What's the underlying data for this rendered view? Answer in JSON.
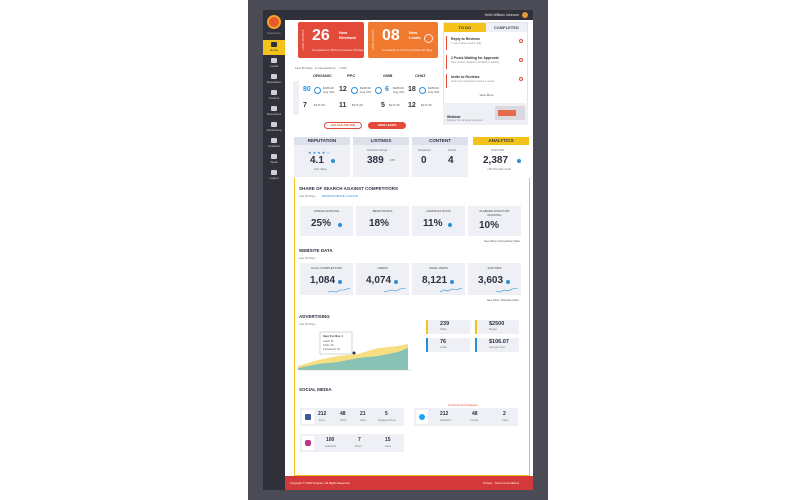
{
  "sidebar": {
    "brand": "Xperience",
    "items": [
      {
        "label": "Home",
        "icon": "home-icon"
      },
      {
        "label": "Leads",
        "icon": "leads-icon"
      },
      {
        "label": "Reputation",
        "icon": "reputation-icon"
      },
      {
        "label": "Content",
        "icon": "content-icon"
      },
      {
        "label": "Directories",
        "icon": "directories-icon"
      },
      {
        "label": "Advertising",
        "icon": "advertising-icon"
      },
      {
        "label": "Analytics",
        "icon": "analytics-icon"
      },
      {
        "label": "Tasks",
        "icon": "tasks-icon"
      },
      {
        "label": "Logout",
        "icon": "logout-icon"
      }
    ]
  },
  "topbar": {
    "user": "Hello William Johnson"
  },
  "stats": {
    "reviews": {
      "side": "LAST 30 DAYS",
      "number": "26",
      "label_line1": "New",
      "label_line2": "Reviews!",
      "sub": "Compared to 18 from previous 30 days"
    },
    "leads": {
      "side": "LAST 30 DAYS",
      "number": "08",
      "label_line1": "New",
      "label_line2": "Leads",
      "sub": "Compared to 6 from previous 30 days"
    }
  },
  "todo": {
    "tab_todo": "TO DO",
    "tab_completed": "COMPLETED",
    "items": [
      {
        "title": "Reply to Reviews",
        "desc": "7 new reviews need a reply"
      },
      {
        "title": "2 Posts Waiting for Approval",
        "desc": "New content created by Scorpion is waiting"
      },
      {
        "title": "Invite to Reviews",
        "desc": "Invite your customers to leave a review"
      }
    ],
    "more": "View More",
    "webinar_title": "Webinar",
    "webinar_desc": "Register for our upcoming event"
  },
  "filters": {
    "range": "Last 30 Days",
    "options": [
      "Comparisons",
      "KPIs"
    ]
  },
  "comparison": {
    "columns": [
      "ORGANIC",
      "PPC",
      "GMB",
      "CHAT"
    ],
    "side": "LAST 30 DAYS",
    "row1": [
      {
        "big": "80",
        "ring": true,
        "small": "$186.00 Avg CPL"
      },
      {
        "big": "12",
        "ring": true,
        "small": "$198.00 Avg CPL"
      },
      {
        "big": "6",
        "ring": true,
        "small": "$186.00 Avg CPL"
      },
      {
        "big": "18",
        "ring": true,
        "small": "$186.00 Avg CPL"
      }
    ],
    "row2": [
      {
        "big": "7",
        "small": "$171.00"
      },
      {
        "big": "11",
        "small": "$171.00"
      },
      {
        "big": "5",
        "small": "$171.00"
      },
      {
        "big": "12",
        "small": "$171.00"
      }
    ]
  },
  "buttons": {
    "calculate": "CALCULATE ROI",
    "view_leads": "VIEW LEADS"
  },
  "tabs": {
    "reputation": {
      "title": "REPUTATION",
      "value": "4.1",
      "stars": "★★★★☆",
      "sub": "Your rating"
    },
    "listings": {
      "title": "LISTINGS",
      "value": "389",
      "sub_top": "Active live listings",
      "sub_bottom": "/ 450"
    },
    "content": {
      "title": "CONTENT",
      "left_value": "0",
      "left_sub": "Scheduled",
      "right_value": "4",
      "right_sub": "Posted"
    },
    "analytics": {
      "title": "ANALYTICS",
      "value": "2,387",
      "sub": "Total Traffic",
      "sub2": "+3% from last month"
    }
  },
  "share_of_search": {
    "title": "SHARE OF SEARCH AGAINST COMPETITORS",
    "range": "Last 30 Days",
    "link": "DEMONSTRATE LAUNCH",
    "items": [
      {
        "name": "HINKLE ROOFING",
        "value": "25%"
      },
      {
        "name": "BEAR ROOFS",
        "value": "18%"
      },
      {
        "name": "CARDINAL ROOF",
        "value": "11%"
      },
      {
        "name": "ALABAMA DISCOUNT ROOFING",
        "value": "10%"
      }
    ],
    "more": "See More Competitor Data"
  },
  "website_data": {
    "title": "WEBSITE DATA",
    "range": "Last 30 Days",
    "items": [
      {
        "name": "GOAL COMPLETIONS",
        "value": "1,084"
      },
      {
        "name": "USERS",
        "value": "4,074"
      },
      {
        "name": "PAGE VIEWS",
        "value": "8,121"
      },
      {
        "name": "VISITORS",
        "value": "3,603"
      }
    ],
    "more": "See More Website Data"
  },
  "advertising": {
    "title": "ADVERTISING",
    "range": "Last 30 Days",
    "tooltip": {
      "title": "Sept. 8 to Nov. 1",
      "rows": [
        "Leads: 60",
        "Clicks: 40",
        "Impressions: 20"
      ]
    },
    "stats": [
      {
        "value": "239",
        "label": "Clicks",
        "color": "#f3c21b"
      },
      {
        "value": "$2500",
        "label": "Budget",
        "color": "#f3c21b"
      },
      {
        "value": "76",
        "label": "Leads",
        "color": "#2c8fd6"
      },
      {
        "value": "$106.07",
        "label": "Cost per Lead",
        "color": "#2c8fd6"
      }
    ]
  },
  "social": {
    "title": "SOCIAL MEDIA",
    "connect": "Connect and Analytics",
    "facebook": {
      "icon": "facebook-icon",
      "values": [
        {
          "v": "212",
          "l": "Fans"
        },
        {
          "v": "48",
          "l": "Posts"
        },
        {
          "v": "21",
          "l": "Likes"
        },
        {
          "v": "5",
          "l": "Engaged Users"
        }
      ]
    },
    "twitter": {
      "icon": "twitter-icon",
      "values": [
        {
          "v": "212",
          "l": "Followers"
        },
        {
          "v": "48",
          "l": "Tweets"
        },
        {
          "v": "2",
          "l": "Likes"
        }
      ]
    },
    "instagram": {
      "icon": "instagram-icon",
      "values": [
        {
          "v": "100",
          "l": "Followers"
        },
        {
          "v": "7",
          "l": "Posts"
        },
        {
          "v": "15",
          "l": "Likes"
        }
      ]
    }
  },
  "footer": {
    "left": "Copyright © 2019 Scorpion. All Rights Reserved.",
    "right": "Privacy · Terms & Conditions"
  },
  "colors": {
    "accent": "#f3c21b",
    "red": "#e34a3a",
    "orange": "#f07a2f",
    "blue": "#2c8fd6",
    "sidebar": "#2f3039"
  }
}
